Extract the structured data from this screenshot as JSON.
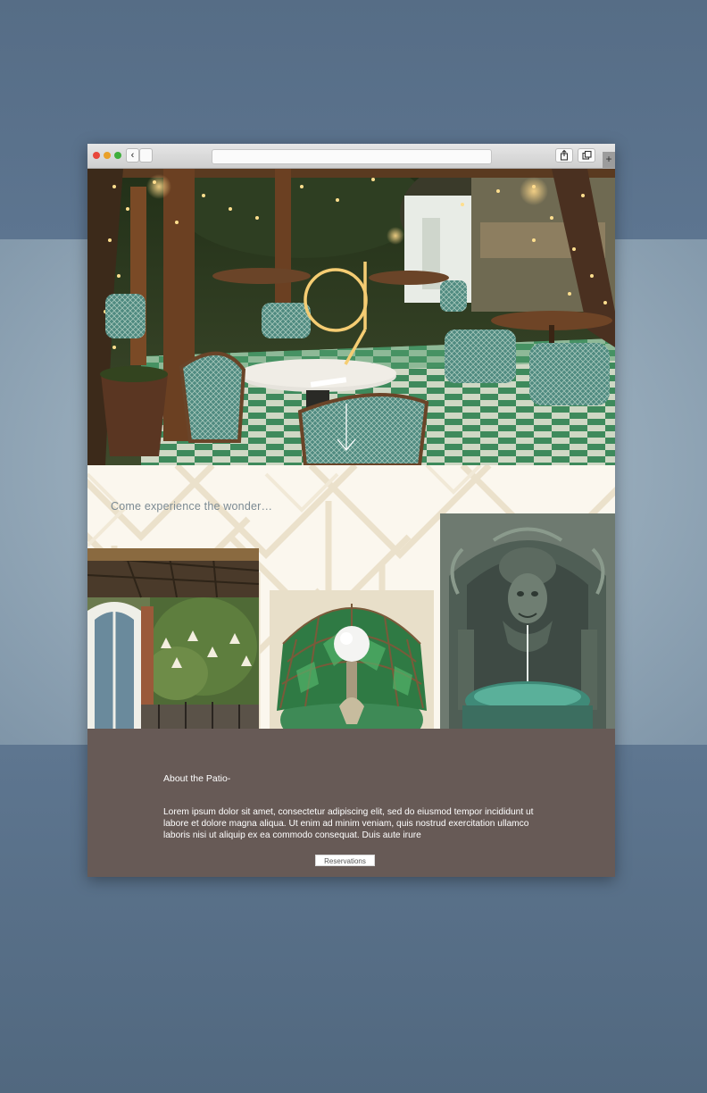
{
  "browser": {
    "back_label": "‹",
    "new_tab_label": "+",
    "controls": [
      "close",
      "minimize",
      "zoom"
    ],
    "toolbar_icons": [
      "share-icon",
      "tabs-icon"
    ]
  },
  "hero": {
    "logo_color": "#f5cd73"
  },
  "content": {
    "tagline": "Come experience the wonder…"
  },
  "about": {
    "title": "About the Patio-",
    "body": "Lorem ipsum dolor sit amet, consectetur adipiscing elit, sed do eiusmod tempor incididunt ut labore et dolore magna aliqua. Ut enim ad minim veniam, quis nostrud exercitation ullamco laboris nisi ut aliquip ex ea commodo consequat. Duis aute irure",
    "button_label": "Reservations",
    "background_color": "#675a56"
  }
}
